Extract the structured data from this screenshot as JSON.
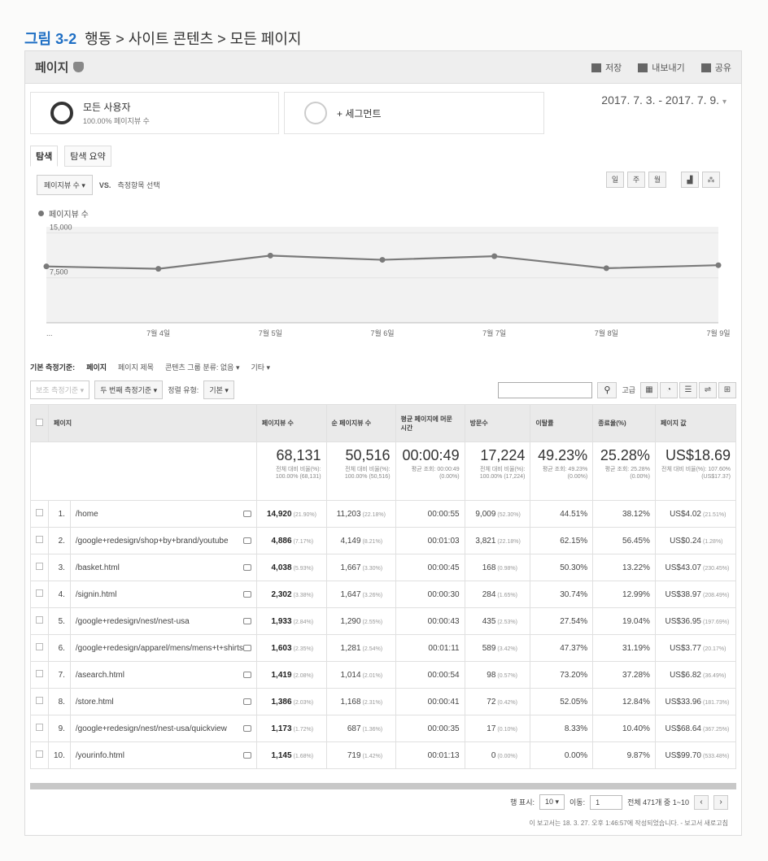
{
  "caption": {
    "number": "그림 3-2",
    "path": "행동 > 사이트 콘텐츠 > 모든 페이지"
  },
  "header": {
    "title": "페이지",
    "actions": {
      "save": "저장",
      "export": "내보내기",
      "share": "공유"
    }
  },
  "segments": {
    "all_users": {
      "name": "모든 사용자",
      "pct": "100.00% 페이지뷰 수"
    },
    "add": "+ 세그먼트"
  },
  "date_range": "2017. 7. 3. - 2017. 7. 9.",
  "tabs": [
    "탐색",
    "탐색 요약"
  ],
  "metric_select": {
    "metric": "페이지뷰 수 ▾",
    "vs": "VS.",
    "choose": "측정항목 선택"
  },
  "chart_ctrl": [
    "일",
    "주",
    "월"
  ],
  "legend_label": "페이지뷰 수",
  "chart_data": {
    "type": "line",
    "series": [
      {
        "name": "페이지뷰 수",
        "values": [
          9400,
          9000,
          11200,
          10500,
          11100,
          9100,
          9600
        ]
      }
    ],
    "x": [
      "",
      "7월 4일",
      "7월 5일",
      "7월 6일",
      "7월 7일",
      "7월 8일",
      "7월 9일"
    ],
    "x_first_label": "...",
    "y_ticks": [
      {
        "v": 15000,
        "label": "15,000"
      },
      {
        "v": 7500,
        "label": "7,500"
      }
    ],
    "ylim": [
      0,
      16000
    ],
    "color": "#7a7a7a"
  },
  "dims": {
    "prefix": "기본 측정기준:",
    "items": [
      "페이지",
      "페이지 제목",
      "콘텐츠 그룹 분류: 없음 ▾",
      "기타 ▾"
    ]
  },
  "filters": {
    "secondary_faded": "보조 측정기준 ▾",
    "secondary": "두 번째 측정기준 ▾",
    "sort_label": "정렬 유형:",
    "sort": "기본 ▾",
    "advanced": "고급"
  },
  "table": {
    "headers": [
      "페이지",
      "페이지뷰 수",
      "순 페이지뷰 수",
      "평균 페이지에 머문 시간",
      "방문수",
      "이탈률",
      "종료율(%)",
      "페이지 값"
    ],
    "totals": [
      {
        "value": "68,131",
        "sub": "전체 대비 비율(%): 100.00% (68,131)"
      },
      {
        "value": "50,516",
        "sub": "전체 대비 비율(%): 100.00% (50,516)"
      },
      {
        "value": "00:00:49",
        "sub": "평균 조회: 00:00:49 (0.00%)"
      },
      {
        "value": "17,224",
        "sub": "전체 대비 비율(%): 100.00% (17,224)"
      },
      {
        "value": "49.23%",
        "sub": "평균 조회: 49.23% (0.00%)"
      },
      {
        "value": "25.28%",
        "sub": "평균 조회: 25.28% (0.00%)"
      },
      {
        "value": "US$18.69",
        "sub": "전체 대비 비율(%): 107.60% (US$17.37)"
      }
    ],
    "rows": [
      {
        "idx": "1.",
        "page": "/home",
        "pv": "14,920",
        "pv_pct": "(21.90%)",
        "upv": "11,203",
        "upv_pct": "(22.18%)",
        "time": "00:00:55",
        "ent": "9,009",
        "ent_pct": "(52.30%)",
        "bounce": "44.51%",
        "exit": "38.12%",
        "value": "US$4.02",
        "value_pct": "(21.51%)"
      },
      {
        "idx": "2.",
        "page": "/google+redesign/shop+by+brand/youtube",
        "pv": "4,886",
        "pv_pct": "(7.17%)",
        "upv": "4,149",
        "upv_pct": "(8.21%)",
        "time": "00:01:03",
        "ent": "3,821",
        "ent_pct": "(22.18%)",
        "bounce": "62.15%",
        "exit": "56.45%",
        "value": "US$0.24",
        "value_pct": "(1.28%)"
      },
      {
        "idx": "3.",
        "page": "/basket.html",
        "pv": "4,038",
        "pv_pct": "(5.93%)",
        "upv": "1,667",
        "upv_pct": "(3.30%)",
        "time": "00:00:45",
        "ent": "168",
        "ent_pct": "(0.98%)",
        "bounce": "50.30%",
        "exit": "13.22%",
        "value": "US$43.07",
        "value_pct": "(230.45%)"
      },
      {
        "idx": "4.",
        "page": "/signin.html",
        "pv": "2,302",
        "pv_pct": "(3.38%)",
        "upv": "1,647",
        "upv_pct": "(3.26%)",
        "time": "00:00:30",
        "ent": "284",
        "ent_pct": "(1.65%)",
        "bounce": "30.74%",
        "exit": "12.99%",
        "value": "US$38.97",
        "value_pct": "(208.49%)"
      },
      {
        "idx": "5.",
        "page": "/google+redesign/nest/nest-usa",
        "pv": "1,933",
        "pv_pct": "(2.84%)",
        "upv": "1,290",
        "upv_pct": "(2.55%)",
        "time": "00:00:43",
        "ent": "435",
        "ent_pct": "(2.53%)",
        "bounce": "27.54%",
        "exit": "19.04%",
        "value": "US$36.95",
        "value_pct": "(197.69%)"
      },
      {
        "idx": "6.",
        "page": "/google+redesign/apparel/mens/mens+t+shirts",
        "pv": "1,603",
        "pv_pct": "(2.35%)",
        "upv": "1,281",
        "upv_pct": "(2.54%)",
        "time": "00:01:11",
        "ent": "589",
        "ent_pct": "(3.42%)",
        "bounce": "47.37%",
        "exit": "31.19%",
        "value": "US$3.77",
        "value_pct": "(20.17%)"
      },
      {
        "idx": "7.",
        "page": "/asearch.html",
        "pv": "1,419",
        "pv_pct": "(2.08%)",
        "upv": "1,014",
        "upv_pct": "(2.01%)",
        "time": "00:00:54",
        "ent": "98",
        "ent_pct": "(0.57%)",
        "bounce": "73.20%",
        "exit": "37.28%",
        "value": "US$6.82",
        "value_pct": "(36.49%)"
      },
      {
        "idx": "8.",
        "page": "/store.html",
        "pv": "1,386",
        "pv_pct": "(2.03%)",
        "upv": "1,168",
        "upv_pct": "(2.31%)",
        "time": "00:00:41",
        "ent": "72",
        "ent_pct": "(0.42%)",
        "bounce": "52.05%",
        "exit": "12.84%",
        "value": "US$33.96",
        "value_pct": "(181.73%)"
      },
      {
        "idx": "9.",
        "page": "/google+redesign/nest/nest-usa/quickview",
        "pv": "1,173",
        "pv_pct": "(1.72%)",
        "upv": "687",
        "upv_pct": "(1.36%)",
        "time": "00:00:35",
        "ent": "17",
        "ent_pct": "(0.10%)",
        "bounce": "8.33%",
        "exit": "10.40%",
        "value": "US$68.64",
        "value_pct": "(367.25%)"
      },
      {
        "idx": "10.",
        "page": "/yourinfo.html",
        "pv": "1,145",
        "pv_pct": "(1.68%)",
        "upv": "719",
        "upv_pct": "(1.42%)",
        "time": "00:01:13",
        "ent": "0",
        "ent_pct": "(0.00%)",
        "bounce": "0.00%",
        "exit": "9.87%",
        "value": "US$99.70",
        "value_pct": "(533.48%)"
      }
    ]
  },
  "pager": {
    "show_label": "행 표시:",
    "show_value": "10 ▾",
    "goto_label": "이동:",
    "goto_value": "1",
    "range": "전체 471개 중 1~10"
  },
  "report_note": "이 보고서는 18. 3. 27. 오후 1:46:57에 작성되었습니다. - 보고서 새로고침"
}
